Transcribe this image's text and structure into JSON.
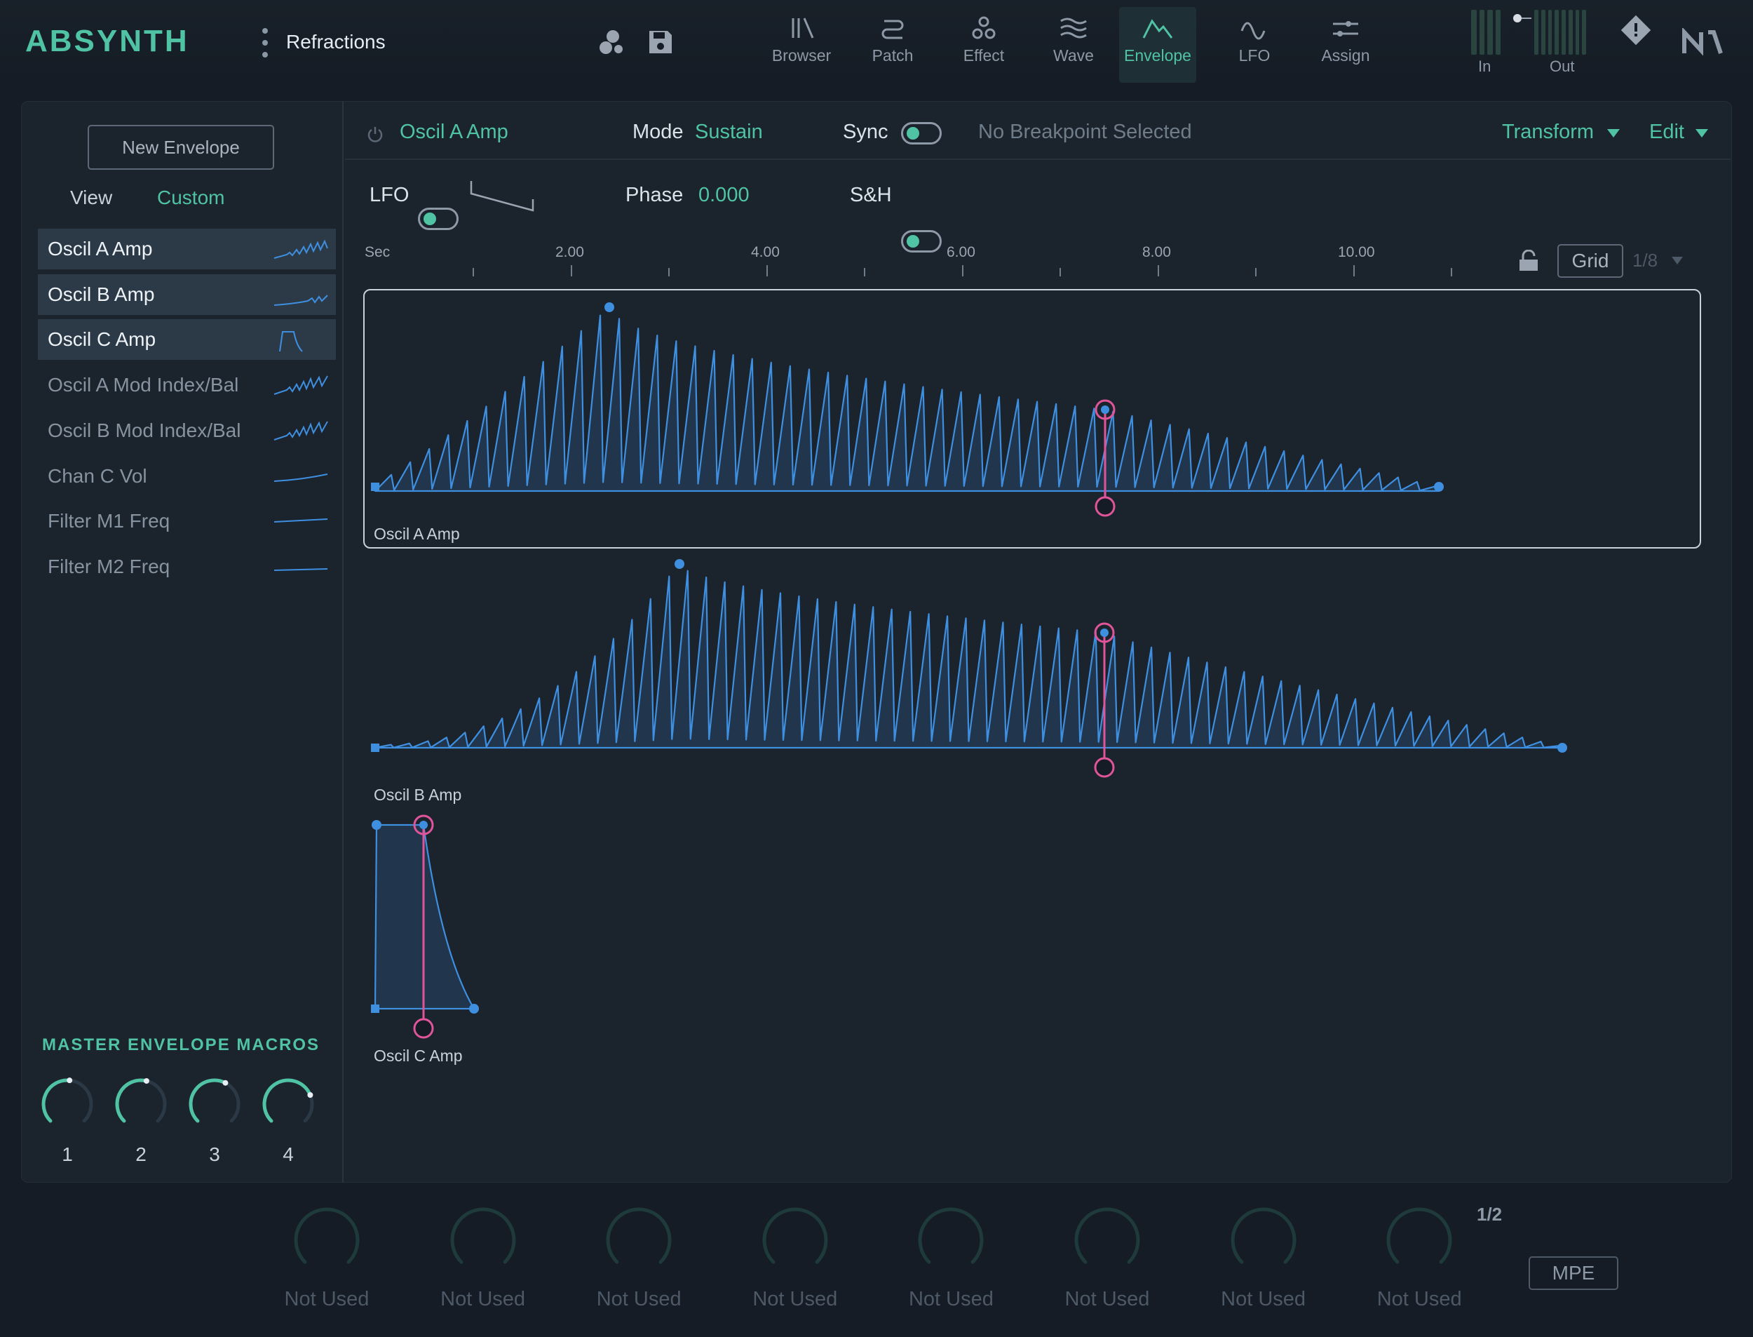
{
  "app": {
    "name": "ABSYNTH",
    "patch_name": "Refractions"
  },
  "nav": [
    {
      "label": "Browser",
      "icon": "browser-icon"
    },
    {
      "label": "Patch",
      "icon": "patch-icon"
    },
    {
      "label": "Effect",
      "icon": "effect-icon"
    },
    {
      "label": "Wave",
      "icon": "wave-icon"
    },
    {
      "label": "Envelope",
      "icon": "envelope-icon",
      "active": true
    },
    {
      "label": "LFO",
      "icon": "lfo-icon"
    },
    {
      "label": "Assign",
      "icon": "assign-icon"
    }
  ],
  "meters": {
    "in_label": "In",
    "out_label": "Out"
  },
  "sidebar": {
    "new_envelope_label": "New Envelope",
    "view_label": "View",
    "view_value": "Custom",
    "items": [
      {
        "label": "Oscil A Amp",
        "selected": true
      },
      {
        "label": "Oscil B Amp",
        "selected": true
      },
      {
        "label": "Oscil C Amp",
        "selected": true
      },
      {
        "label": "Oscil A Mod Index/Bal",
        "selected": false
      },
      {
        "label": "Oscil B Mod Index/Bal",
        "selected": false
      },
      {
        "label": "Chan C Vol",
        "selected": false
      },
      {
        "label": "Filter M1 Freq",
        "selected": false
      },
      {
        "label": "Filter M2 Freq",
        "selected": false
      }
    ],
    "macros_title": "MASTER ENVELOPE MACROS",
    "macros": [
      {
        "label": "1",
        "value": 0.52
      },
      {
        "label": "2",
        "value": 0.55
      },
      {
        "label": "3",
        "value": 0.6
      },
      {
        "label": "4",
        "value": 0.75
      }
    ]
  },
  "editor": {
    "envelope_name": "Oscil A Amp",
    "mode_label": "Mode",
    "mode_value": "Sustain",
    "sync_label": "Sync",
    "sync_on": true,
    "breakpoint_status": "No Breakpoint Selected",
    "transform_label": "Transform",
    "edit_label": "Edit",
    "lfo_label": "LFO",
    "lfo_on": true,
    "phase_label": "Phase",
    "phase_value": "0.000",
    "sh_label": "S&H",
    "sh_on": true,
    "ruler_unit": "Sec",
    "ruler_ticks": [
      "2.00",
      "4.00",
      "6.00",
      "8.00",
      "10.00"
    ],
    "grid_label": "Grid",
    "grid_value": "1/8",
    "envelopes": [
      {
        "label": "Oscil A Amp"
      },
      {
        "label": "Oscil B Amp"
      },
      {
        "label": "Oscil C Amp"
      }
    ]
  },
  "macros_bottom": {
    "page": "1/2",
    "mpe_label": "MPE",
    "slots": [
      "Not Used",
      "Not Used",
      "Not Used",
      "Not Used",
      "Not Used",
      "Not Used",
      "Not Used",
      "Not Used"
    ]
  },
  "colors": {
    "accent": "#4fc3a4",
    "curve": "#3f8fe0",
    "marker": "#e0559a",
    "background": "#151c25"
  }
}
